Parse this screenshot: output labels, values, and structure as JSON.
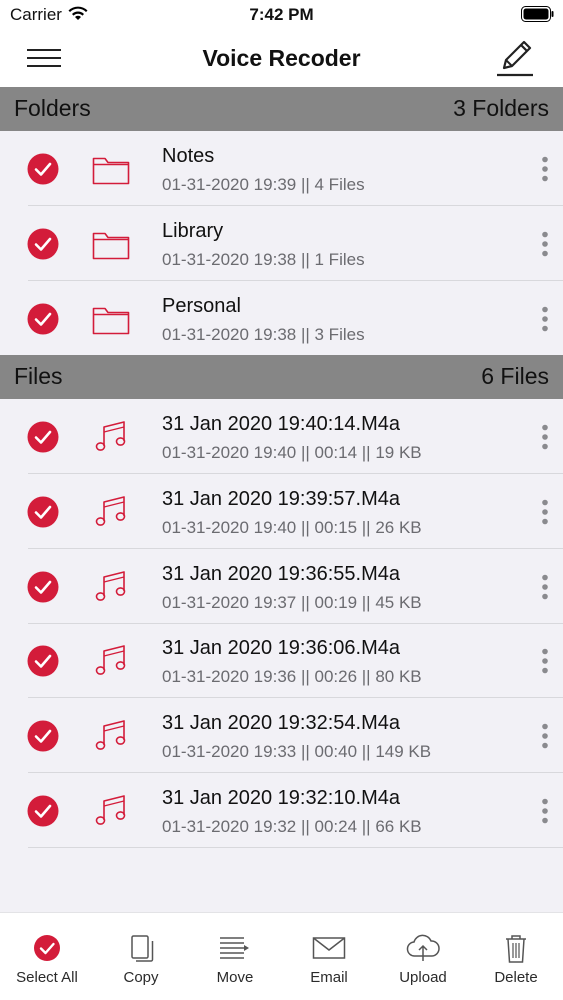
{
  "status_bar": {
    "carrier": "Carrier",
    "time": "7:42 PM"
  },
  "nav": {
    "title": "Voice Recoder"
  },
  "accent_color": "#d31c3a",
  "folders_section": {
    "title": "Folders",
    "count": "3 Folders",
    "items": [
      {
        "name": "Notes",
        "meta": "01-31-2020 19:39 || 4 Files"
      },
      {
        "name": "Library",
        "meta": "01-31-2020 19:38 || 1 Files"
      },
      {
        "name": "Personal",
        "meta": "01-31-2020 19:38 || 3 Files"
      }
    ]
  },
  "files_section": {
    "title": "Files",
    "count": "6 Files",
    "items": [
      {
        "name": "31 Jan 2020 19:40:14.M4a",
        "meta": "01-31-2020 19:40 || 00:14 || 19 KB"
      },
      {
        "name": "31 Jan 2020 19:39:57.M4a",
        "meta": "01-31-2020 19:40 || 00:15 || 26 KB"
      },
      {
        "name": "31 Jan 2020 19:36:55.M4a",
        "meta": "01-31-2020 19:37 || 00:19 || 45 KB"
      },
      {
        "name": "31 Jan 2020 19:36:06.M4a",
        "meta": "01-31-2020 19:36 || 00:26 || 80 KB"
      },
      {
        "name": "31 Jan 2020 19:32:54.M4a",
        "meta": "01-31-2020 19:33 || 00:40 || 149 KB"
      },
      {
        "name": "31 Jan 2020 19:32:10.M4a",
        "meta": "01-31-2020 19:32 || 00:24 || 66 KB"
      }
    ]
  },
  "toolbar": {
    "select_all": "Select All",
    "copy": "Copy",
    "move": "Move",
    "email": "Email",
    "upload": "Upload",
    "delete": "Delete"
  }
}
